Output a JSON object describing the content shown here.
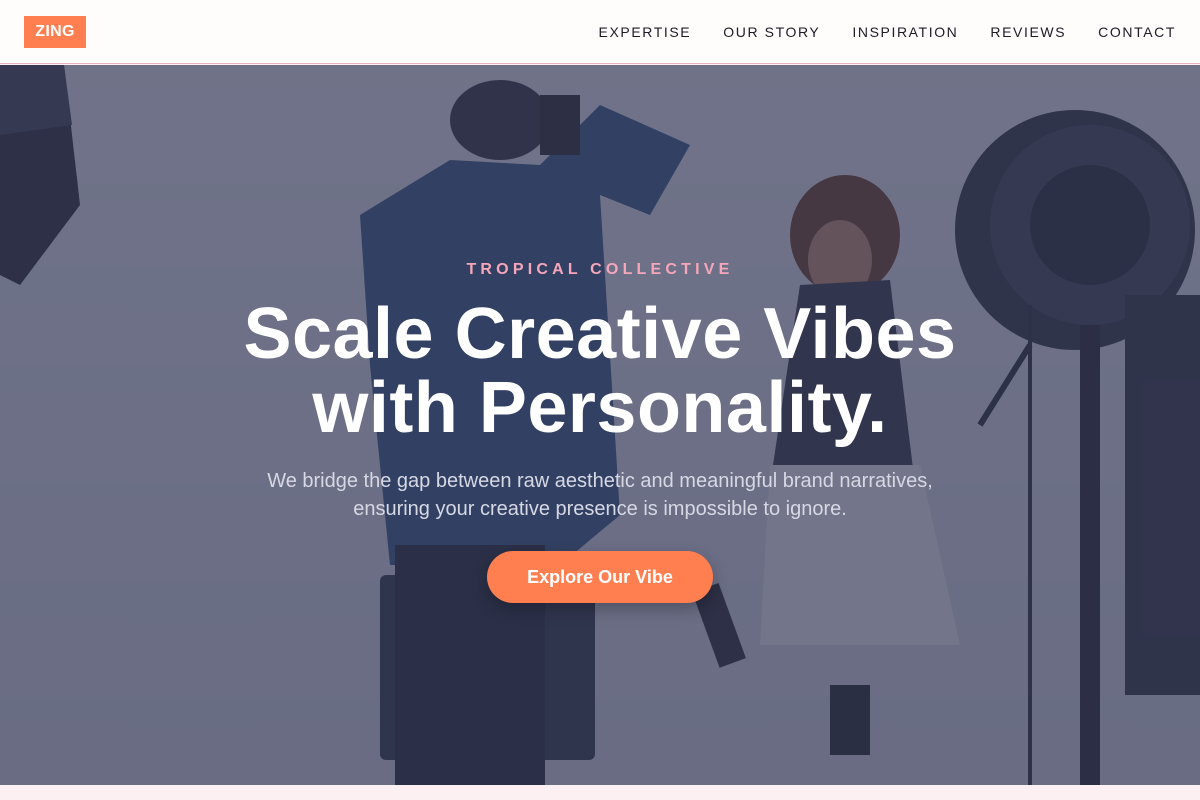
{
  "header": {
    "logo": "ZING",
    "nav": [
      "EXPERTISE",
      "OUR STORY",
      "INSPIRATION",
      "REVIEWS",
      "CONTACT"
    ]
  },
  "hero": {
    "eyebrow": "TROPICAL COLLECTIVE",
    "headline_line1": "Scale Creative Vibes",
    "headline_line2": "with Personality.",
    "subtext": "We bridge the gap between raw aesthetic and meaningful brand narratives, ensuring your creative presence is impossible to ignore.",
    "cta_label": "Explore Our Vibe",
    "image_subject": "photographer shooting a smiling model in a studio with lighting equipment"
  },
  "colors": {
    "accent": "#ff7f50",
    "eyebrow": "#f6a6ba",
    "header_bg": "#fffcfc",
    "overlay": "#343654"
  }
}
